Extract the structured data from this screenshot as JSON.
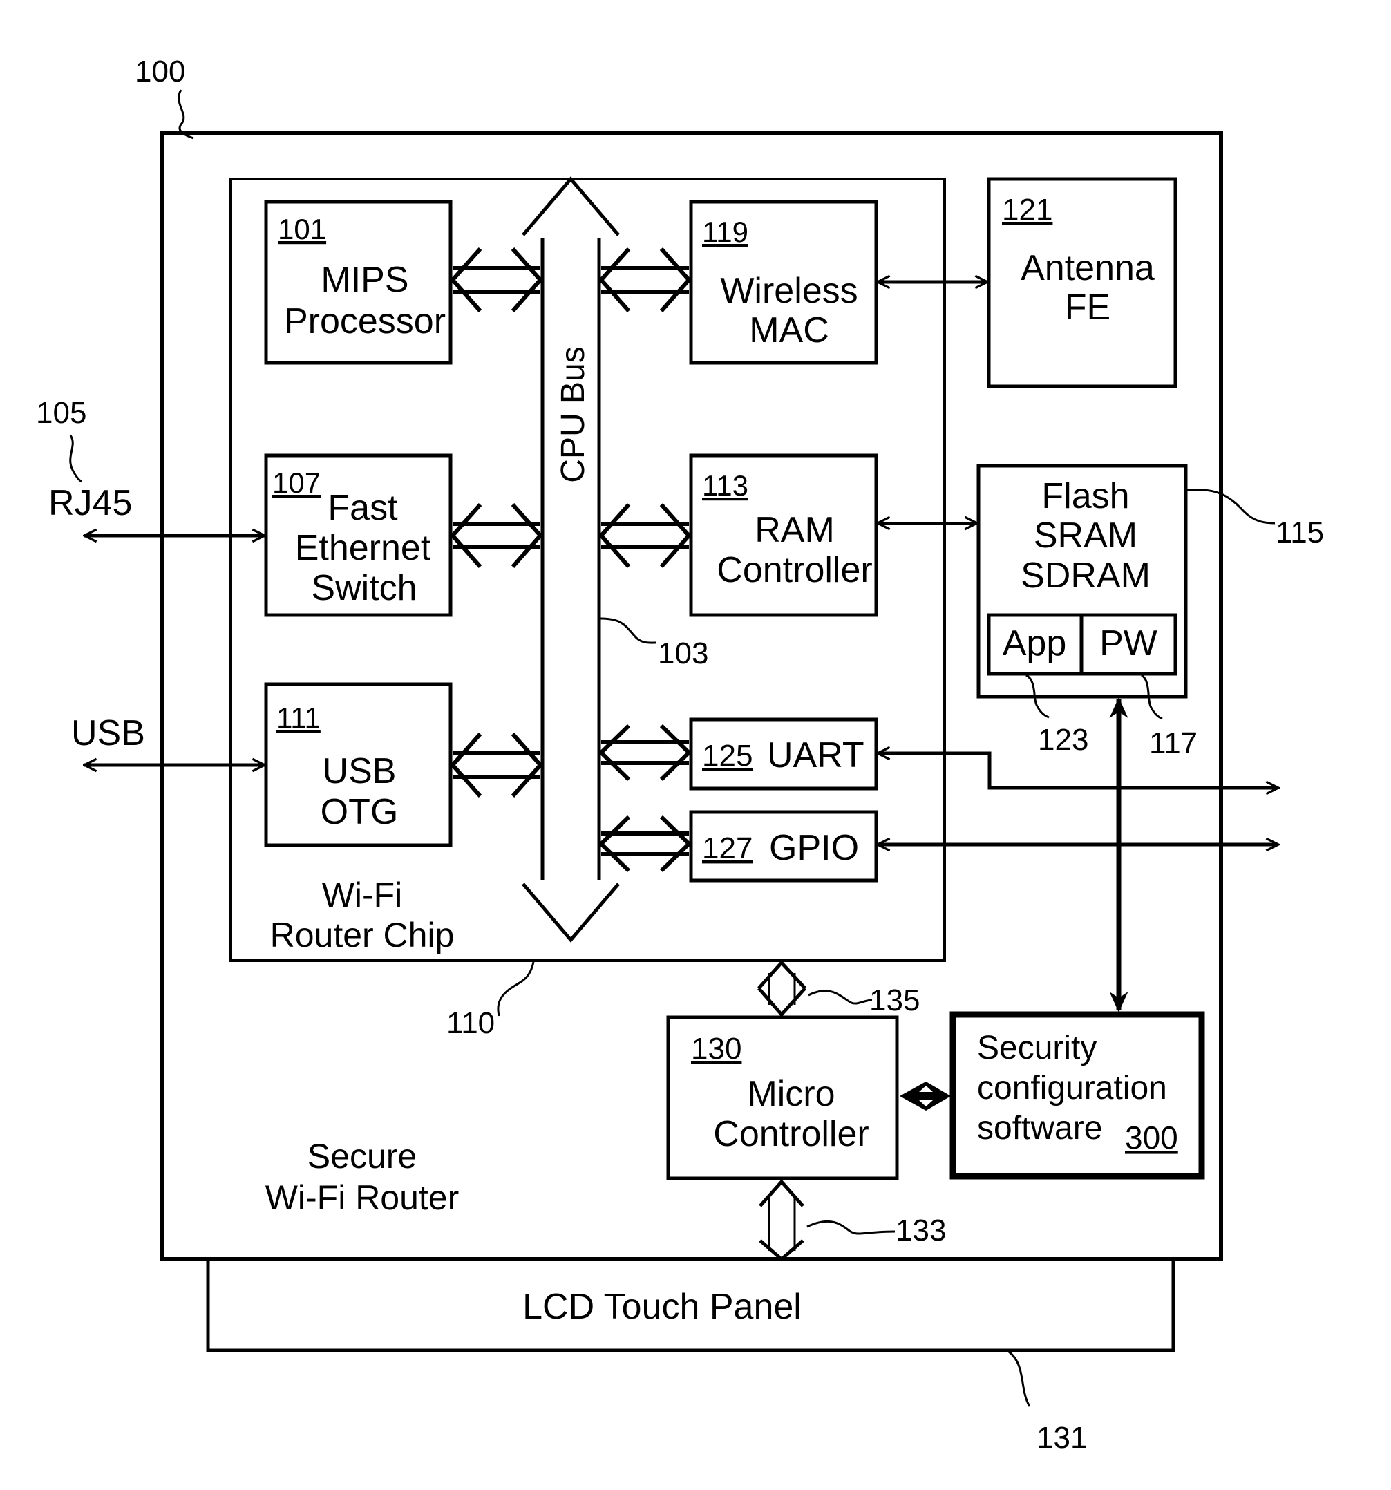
{
  "figure": {
    "device_ref": "100",
    "device_label": [
      "Secure",
      "Wi-Fi Router"
    ],
    "chip": {
      "ref": "110",
      "label": [
        "Wi-Fi",
        "Router Chip"
      ]
    },
    "bus": {
      "ref": "103",
      "label": "CPU Bus"
    },
    "blocks": {
      "mips": {
        "ref": "101",
        "label": [
          "MIPS",
          "Processor"
        ]
      },
      "ethernet": {
        "ref": "107",
        "label": [
          "Fast",
          "Ethernet",
          "Switch"
        ]
      },
      "usb_otg": {
        "ref": "111",
        "label": [
          "USB",
          "OTG"
        ]
      },
      "wireless_mac": {
        "ref": "119",
        "label": [
          "Wireless",
          "MAC"
        ]
      },
      "ram_controller": {
        "ref": "113",
        "label": [
          "RAM",
          "Controller"
        ]
      },
      "uart": {
        "ref": "125",
        "label": "UART"
      },
      "gpio": {
        "ref": "127",
        "label": "GPIO"
      },
      "antenna": {
        "ref": "121",
        "label": [
          "Antenna",
          "FE"
        ]
      },
      "memory": {
        "ref": "115",
        "label": [
          "Flash",
          "SRAM",
          "SDRAM"
        ],
        "app": {
          "ref": "123",
          "label": "App"
        },
        "pw": {
          "ref": "117",
          "label": "PW"
        }
      },
      "micro_controller": {
        "ref": "130",
        "label": [
          "Micro",
          "Controller"
        ]
      },
      "security_software": {
        "ref": "300",
        "label": [
          "Security",
          "configuration",
          "software"
        ]
      },
      "lcd_panel": {
        "ref": "131",
        "label": "LCD Touch Panel"
      }
    },
    "external_ports": {
      "rj45": {
        "ref": "105",
        "label": "RJ45"
      },
      "usb": {
        "label": "USB"
      }
    },
    "links": {
      "chip_to_mcu": {
        "ref": "135"
      },
      "mcu_to_lcd": {
        "ref": "133"
      }
    }
  }
}
